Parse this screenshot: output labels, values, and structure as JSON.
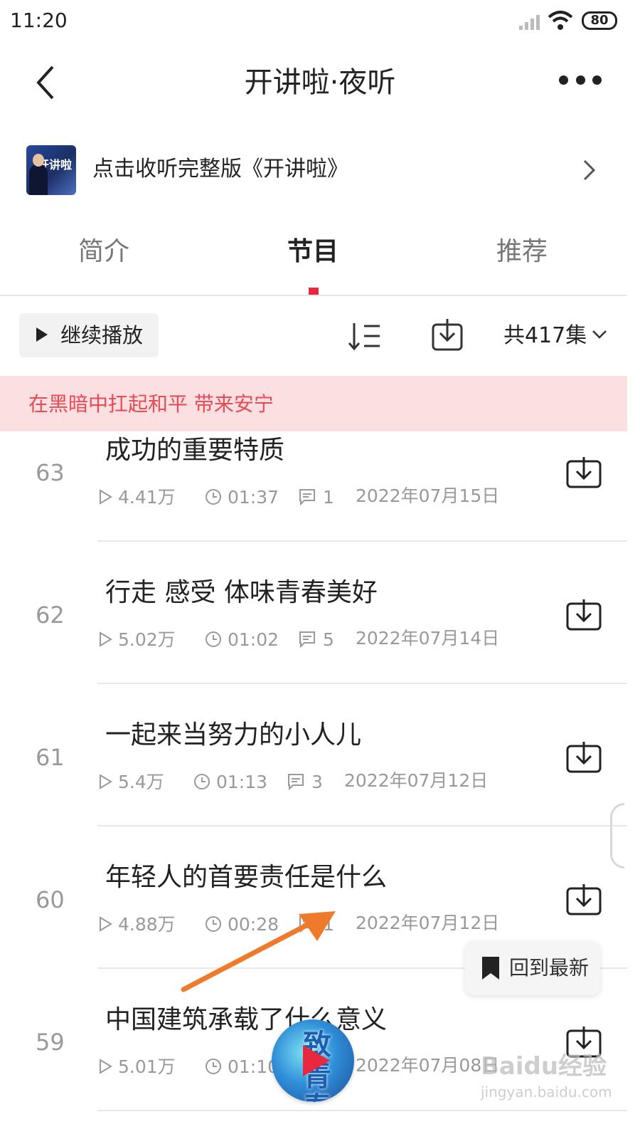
{
  "status_bar": {
    "time": "11:20",
    "battery": "80"
  },
  "header": {
    "title": "开讲啦·夜听"
  },
  "promo": {
    "text": "点击收听完整版《开讲啦》",
    "thumb_logo": "开讲啦"
  },
  "tabs": [
    {
      "label": "简介",
      "active": false
    },
    {
      "label": "节目",
      "active": true
    },
    {
      "label": "推荐",
      "active": false
    }
  ],
  "toolbar": {
    "continue_label": "继续播放",
    "episode_count": "共417集"
  },
  "banner": {
    "text": "在黑暗中扛起和平 带来安宁"
  },
  "episodes": [
    {
      "num": "63",
      "title": "成功的重要特质",
      "plays": "4.41万",
      "duration": "01:37",
      "comments": "1",
      "date": "2022年07月15日"
    },
    {
      "num": "62",
      "title": "行走 感受 体味青春美好",
      "plays": "5.02万",
      "duration": "01:02",
      "comments": "5",
      "date": "2022年07月14日"
    },
    {
      "num": "61",
      "title": "一起来当努力的小人儿",
      "plays": "5.4万",
      "duration": "01:13",
      "comments": "3",
      "date": "2022年07月12日"
    },
    {
      "num": "60",
      "title": "年轻人的首要责任是什么",
      "plays": "4.88万",
      "duration": "00:28",
      "comments": "1",
      "date": "2022年07月12日"
    },
    {
      "num": "59",
      "title": "中国建筑承载了什么意义",
      "plays": "5.01万",
      "duration": "01:10",
      "comments": "",
      "date": "2022年07月08日"
    }
  ],
  "float_button": {
    "label": "回到最新"
  },
  "mini_player": {
    "cover_text": "致青春"
  },
  "watermark": {
    "main": "Baidu经验",
    "sub": "jingyan.baidu.com"
  },
  "colors": {
    "accent": "#e8283e",
    "banner_bg": "#fbdfe1",
    "banner_text": "#e94b56",
    "annotation_arrow": "#f07a2c"
  }
}
